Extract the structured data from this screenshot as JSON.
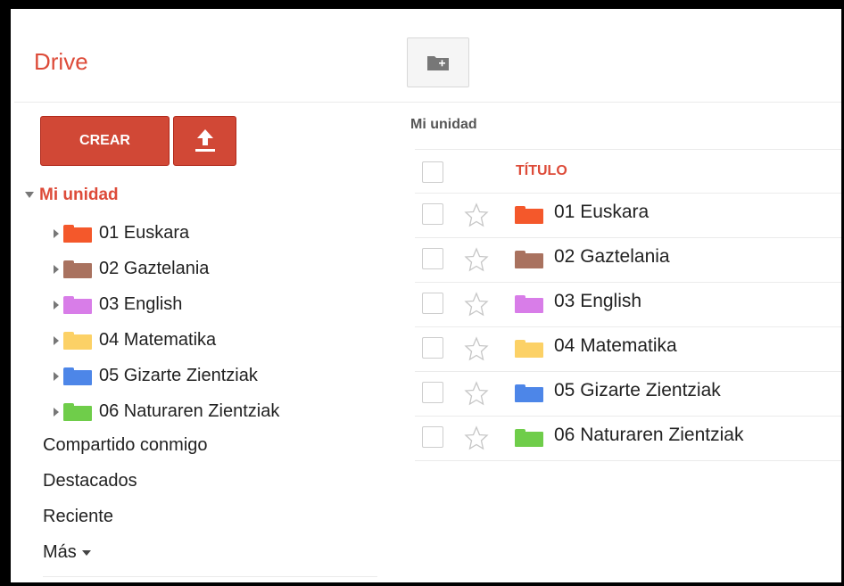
{
  "app": {
    "title": "Drive"
  },
  "toolbar": {
    "new_folder_icon": "folder-plus-icon"
  },
  "sidebar": {
    "create_label": "CREAR",
    "upload_icon": "upload-icon",
    "root_label": "Mi unidad",
    "folders": [
      {
        "label": "01 Euskara",
        "color": "#f4582b"
      },
      {
        "label": "02 Gaztelania",
        "color": "#a9725f"
      },
      {
        "label": "03 English",
        "color": "#d87de8"
      },
      {
        "label": "04 Matematika",
        "color": "#fcd166"
      },
      {
        "label": "05 Gizarte Zientziak",
        "color": "#4d86e8"
      },
      {
        "label": "06 Naturaren Zientziak",
        "color": "#6fcd4a"
      }
    ],
    "links": [
      "Compartido conmigo",
      "Destacados",
      "Reciente"
    ],
    "more_label": "Más"
  },
  "main": {
    "breadcrumb": "Mi unidad",
    "column_title": "TÍTULO",
    "rows": [
      {
        "label": "01 Euskara",
        "color": "#f4582b"
      },
      {
        "label": "02 Gaztelania",
        "color": "#a9725f"
      },
      {
        "label": "03 English",
        "color": "#d87de8"
      },
      {
        "label": "04 Matematika",
        "color": "#fcd166"
      },
      {
        "label": "05 Gizarte Zientziak",
        "color": "#4d86e8"
      },
      {
        "label": "06 Naturaren Zientziak",
        "color": "#6fcd4a"
      }
    ]
  }
}
